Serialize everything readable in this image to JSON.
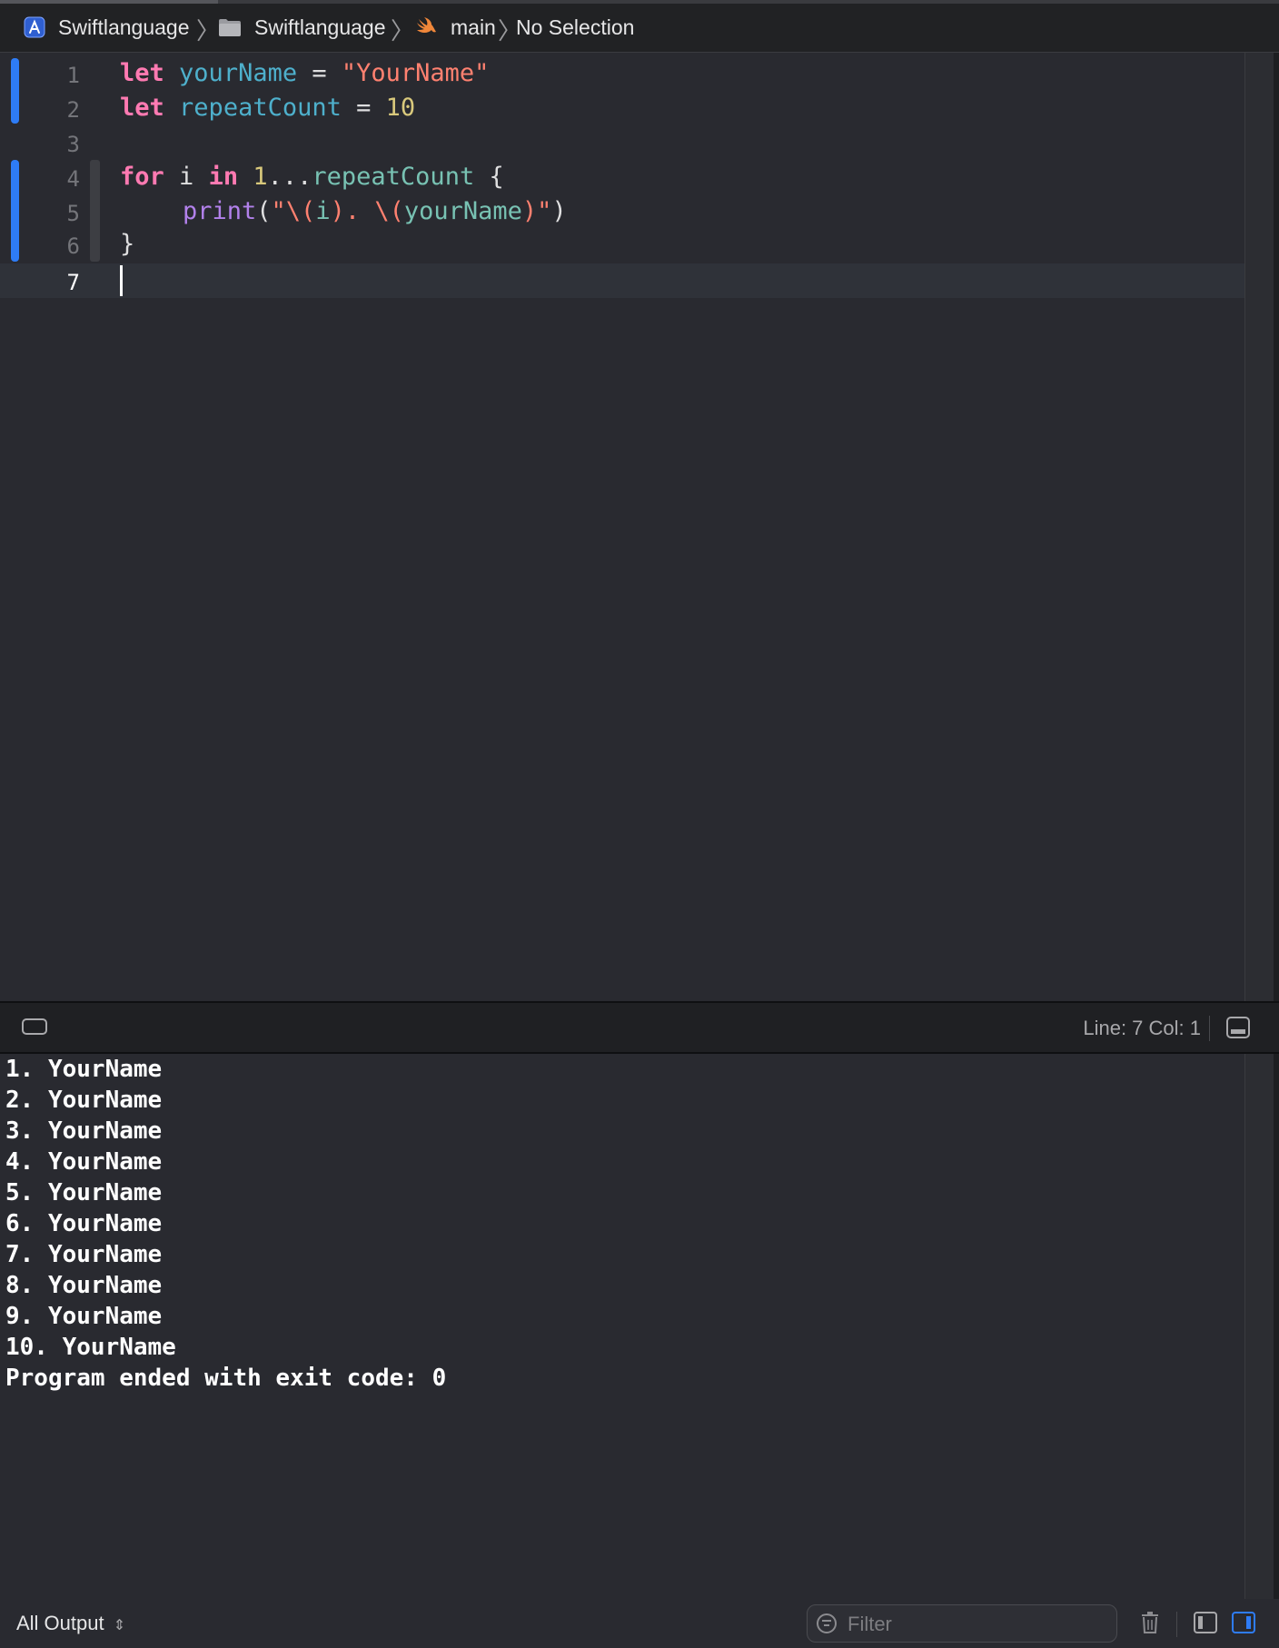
{
  "breadcrumb": {
    "project": "Swiftlanguage",
    "folder": "Swiftlanguage",
    "file": "main",
    "symbol": "No Selection"
  },
  "editor": {
    "line_numbers": [
      "1",
      "2",
      "3",
      "4",
      "5",
      "6",
      "7"
    ],
    "current_line": 7,
    "lines": [
      {
        "kw": "let",
        "name": "yourName",
        "op": " = ",
        "str": "\"YourName\""
      },
      {
        "kw": "let",
        "name": "repeatCount",
        "op": " = ",
        "num": "10"
      },
      {},
      {
        "kw": "for",
        "sp1": " i ",
        "kw2": "in",
        "sp2": " ",
        "num": "1",
        "op": "...",
        "ref": "repeatCount",
        "tail": " {"
      },
      {
        "fn": "print",
        "p1": "(",
        "s1": "\"\\(",
        "ref1": "i",
        "s2": "). \\(",
        "ref2": "yourName",
        "s3": ")\"",
        "p2": ")"
      },
      {
        "brace": "}"
      },
      {}
    ]
  },
  "status": {
    "line_col": "Line: 7  Col: 1"
  },
  "console": {
    "output": [
      "1. YourName",
      "2. YourName",
      "3. YourName",
      "4. YourName",
      "5. YourName",
      "6. YourName",
      "7. YourName",
      "8. YourName",
      "9. YourName",
      "10. YourName",
      "Program ended with exit code: 0"
    ]
  },
  "bottom": {
    "output_filter": "All Output",
    "filter_placeholder": "Filter"
  },
  "icons": {
    "project": "xcode-app-icon",
    "folder": "folder-icon",
    "file": "swift-file-icon"
  },
  "colors": {
    "accent": "#2e7cf6",
    "keyword": "#ff7ab2",
    "string": "#ff8170",
    "number": "#d9c97c",
    "function": "#b281eb"
  }
}
